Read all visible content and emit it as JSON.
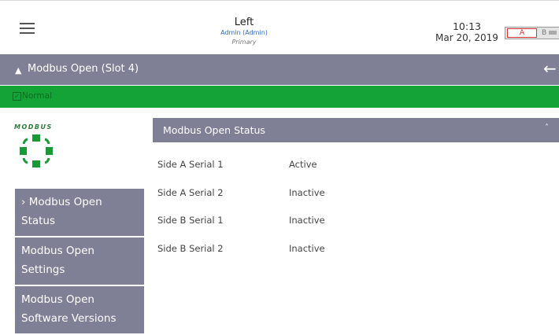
{
  "header": {
    "panel_name": "Left",
    "user": "Admin (Admin)",
    "role": "Primary",
    "time": "10:13",
    "date": "Mar 20, 2019",
    "side_a": "A",
    "side_b": "B"
  },
  "titlebar": {
    "title": "Modbus Open (Slot 4)"
  },
  "status": {
    "text": "Normal",
    "color": "#14a336"
  },
  "logo": {
    "text": "MODBUS"
  },
  "sidebar": {
    "items": [
      {
        "line1": "› Modbus Open",
        "line2": "Status"
      },
      {
        "line1": "Modbus Open",
        "line2": "Settings"
      },
      {
        "line1": "Modbus Open",
        "line2": "Software Versions"
      }
    ]
  },
  "panel": {
    "title": "Modbus Open Status",
    "rows": [
      {
        "label": "Side A Serial 1",
        "value": "Active"
      },
      {
        "label": "Side A Serial 2",
        "value": "Inactive"
      },
      {
        "label": "Side B Serial 1",
        "value": "Inactive"
      },
      {
        "label": "Side B Serial 2",
        "value": "Inactive"
      }
    ]
  },
  "colors": {
    "accent": "#7f7f95",
    "ok": "#14a336",
    "logo": "#1a9a36"
  }
}
